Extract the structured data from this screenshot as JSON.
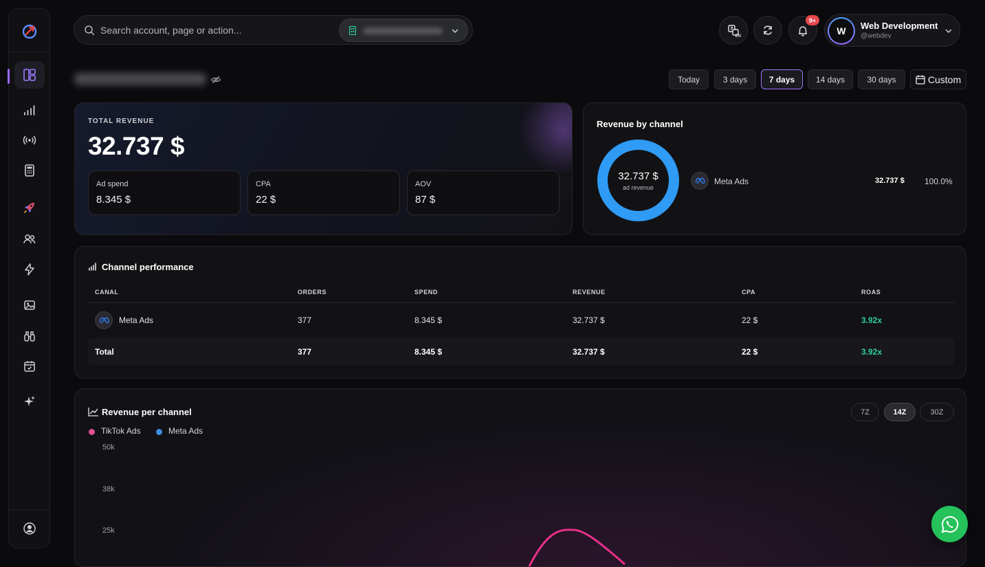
{
  "search": {
    "placeholder": "Search account, page or action..."
  },
  "header": {
    "language_code": "EN",
    "notifications_badge": "9+",
    "profile": {
      "initial": "W",
      "name": "Web Development",
      "handle": "@webdev"
    }
  },
  "date_ranges": [
    "Today",
    "3 days",
    "7 days",
    "14 days",
    "30 days"
  ],
  "date_range_selected": "7 days",
  "custom_label": "Custom",
  "revenue_card": {
    "label": "TOTAL REVENUE",
    "value": "32.737 $",
    "metrics": [
      {
        "label": "Ad spend",
        "value": "8.345 $"
      },
      {
        "label": "CPA",
        "value": "22 $"
      },
      {
        "label": "AOV",
        "value": "87 $"
      }
    ]
  },
  "channel_card": {
    "title": "Revenue by channel",
    "donut_value": "32.737 $",
    "donut_sub": "ad revenue",
    "channels": [
      {
        "name": "Meta Ads",
        "revenue": "32.737 $",
        "share": "100.0%",
        "color": "#2f9bf5"
      }
    ]
  },
  "performance": {
    "title": "Channel performance",
    "columns": [
      "CANAL",
      "ORDERS",
      "SPEND",
      "REVENUE",
      "CPA",
      "ROAS"
    ],
    "rows": [
      {
        "canal": "Meta Ads",
        "orders": "377",
        "spend": "8.345 $",
        "revenue": "32.737 $",
        "cpa": "22 $",
        "roas": "3.92x"
      }
    ],
    "total": {
      "canal": "Total",
      "orders": "377",
      "spend": "8.345 $",
      "revenue": "32.737 $",
      "cpa": "22 $",
      "roas": "3.92x"
    }
  },
  "revenue_chart": {
    "title": "Revenue per channel",
    "period_chips": [
      "7Z",
      "14Z",
      "30Z"
    ],
    "period_selected": "14Z",
    "legend": [
      {
        "name": "TikTok Ads",
        "color": "#e2508f"
      },
      {
        "name": "Meta Ads",
        "color": "#3d8fe0"
      }
    ],
    "y_ticks": [
      "50k",
      "38k",
      "25k"
    ]
  },
  "colors": {
    "accent": "#a277ff",
    "roas_green": "#2bd09b",
    "meta_blue": "#2f9bf5",
    "tiktok_pink": "#e8308a"
  }
}
